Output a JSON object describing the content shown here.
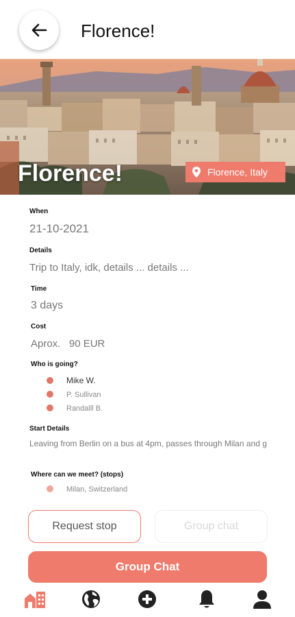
{
  "header": {
    "title": "Florence!"
  },
  "hero": {
    "title": "Florence!",
    "location": "Florence, Italy"
  },
  "details": {
    "when_label": "When",
    "when_value": "21-10-2021",
    "details_label": "Details",
    "details_value": "Trip to Italy, idk, details ... details ...",
    "time_label": "Time",
    "time_value": "3 days",
    "cost_label": "Cost",
    "cost_value": "Aprox.   90 EUR",
    "who_label": "Who is going?",
    "people": [
      "Mike W.",
      "P. Sullivan",
      "Randalll B."
    ],
    "start_label": "Start Details",
    "start_value": "Leaving from Berlin on a bus at 4pm, passes through Milan and g",
    "stops_label": "Where can we meet? (stops)",
    "stops": [
      "Milan, Switzerland"
    ]
  },
  "buttons": {
    "request_stop": "Request stop",
    "group_chat_secondary": "Group chat",
    "group_chat_primary": "Group Chat"
  },
  "colors": {
    "accent": "#ee7b6c",
    "dot": "#e0786a"
  },
  "nav": {
    "items": [
      {
        "icon": "home-icon",
        "active": true
      },
      {
        "icon": "globe-icon",
        "active": false
      },
      {
        "icon": "add-icon",
        "active": false
      },
      {
        "icon": "bell-icon",
        "active": false
      },
      {
        "icon": "profile-icon",
        "active": false
      }
    ]
  }
}
